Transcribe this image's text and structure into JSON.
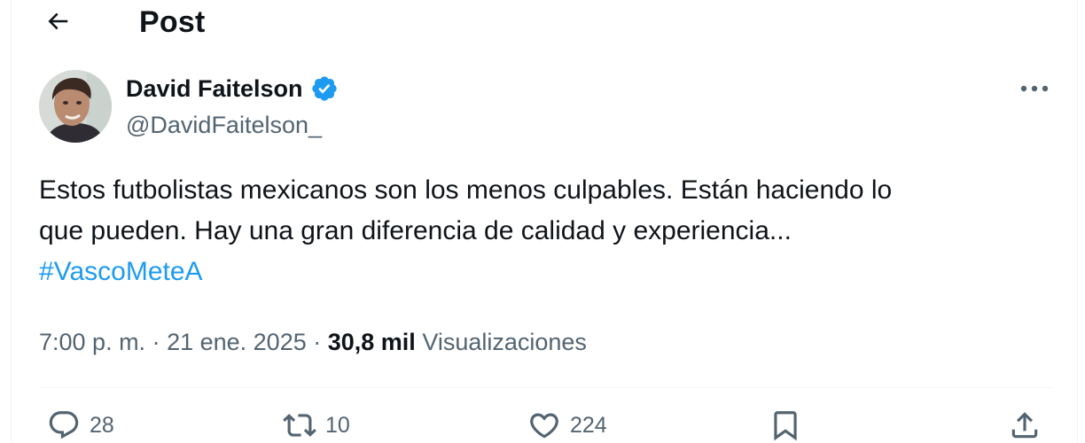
{
  "header": {
    "title": "Post"
  },
  "author": {
    "name": "David Faitelson",
    "handle": "@DavidFaitelson_",
    "verified": true
  },
  "tweet": {
    "line1": "Estos futbolistas mexicanos son los menos culpables. Están haciendo lo",
    "line2": "que pueden. Hay una gran diferencia de calidad y experiencia...",
    "hashtag": "#VascoMeteA"
  },
  "meta": {
    "time": "7:00 p. m.",
    "separator": " · ",
    "date": "21 ene. 2025",
    "views_count": "30,8 mil",
    "views_label": "Visualizaciones"
  },
  "actions": {
    "replies": "28",
    "reposts": "10",
    "likes": "224"
  },
  "icons": {
    "back": "back-arrow-icon",
    "verified": "verified-badge-icon",
    "more": "more-dots-icon",
    "reply": "reply-icon",
    "repost": "repost-icon",
    "like": "heart-icon",
    "bookmark": "bookmark-icon",
    "share": "share-icon"
  },
  "colors": {
    "accent": "#1d9bf0",
    "text_primary": "#0f1419",
    "text_secondary": "#536471",
    "divider": "#eff3f4"
  }
}
